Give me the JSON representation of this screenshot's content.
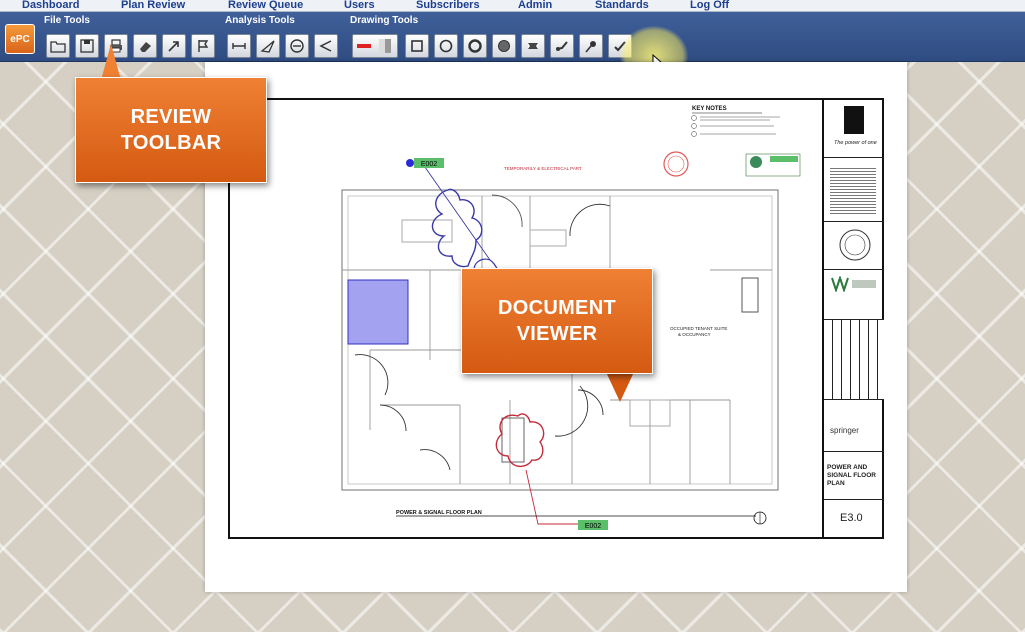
{
  "nav": {
    "items": [
      "Dashboard",
      "Plan Review",
      "Review Queue",
      "Users",
      "Subscribers",
      "Admin",
      "Standards",
      "Log Off"
    ]
  },
  "toolbar": {
    "logo_text": "ePC",
    "group_labels": {
      "file": "File Tools",
      "analysis": "Analysis Tools",
      "drawing": "Drawing Tools"
    },
    "file_tools": [
      "open-folder-icon",
      "save-icon",
      "print-icon",
      "eraser-icon",
      "arrow-icon",
      "flag-icon"
    ],
    "analysis_tools": [
      "measure-line-icon",
      "angle-icon",
      "circle-measure-icon",
      "bend-angle-icon"
    ],
    "drawing_tools": [
      "color-swatch-icon",
      "rectangle-icon",
      "circle-icon",
      "ring-icon",
      "filled-circle-icon",
      "cloud-icon",
      "stamp-icon",
      "pushpin-icon",
      "checkmark-icon"
    ],
    "accent_color": "#2f4c82"
  },
  "callouts": {
    "review_toolbar": {
      "line1": "REVIEW",
      "line2": "TOOLBAR"
    },
    "document_viewer": {
      "line1": "DOCUMENT",
      "line2": "VIEWER"
    },
    "color": "#e06a1e"
  },
  "drawing": {
    "key_notes_title": "KEY NOTES",
    "tag_top": "E002",
    "tag_bottom": "E002",
    "plan_title": "POWER & SIGNAL FLOOR PLAN",
    "red_note": "TEMPORARILY & ELECTRICAL PART",
    "tenant_note_1": "OCCUPIED TENANT SUITE",
    "tenant_note_2": "& OCCUPANCY"
  },
  "title_block": {
    "tagline": "The power of one",
    "company": "springer",
    "sheet_title_1": "POWER AND",
    "sheet_title_2": "SIGNAL FLOOR",
    "sheet_title_3": "PLAN",
    "sheet_number": "E3.0"
  }
}
